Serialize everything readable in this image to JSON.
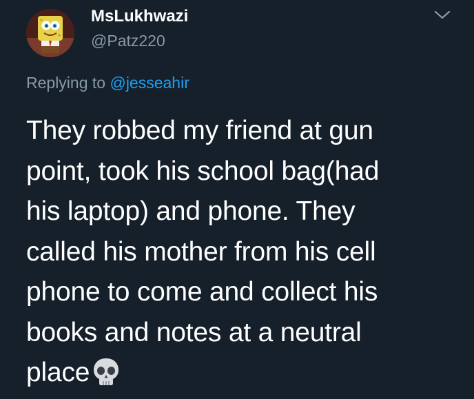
{
  "tweet": {
    "display_name": "MsLukhwazi",
    "handle": "@Patz220",
    "replying_prefix": "Replying to ",
    "replying_to": "@jesseahir",
    "body_lines": [
      "They robbed my friend at gun",
      "point, took his school bag(had",
      "his laptop) and phone. They",
      "called his mother from his cell",
      "phone to come and collect his",
      "books and notes at a neutral",
      "place"
    ],
    "trailing_emoji": "skull-emoji"
  },
  "icons": {
    "menu": "chevron-down-icon",
    "avatar": "spongebob-avatar"
  },
  "colors": {
    "background": "#15202b",
    "primary_text": "#ffffff",
    "secondary_text": "#8899a6",
    "accent": "#1da1f2"
  }
}
